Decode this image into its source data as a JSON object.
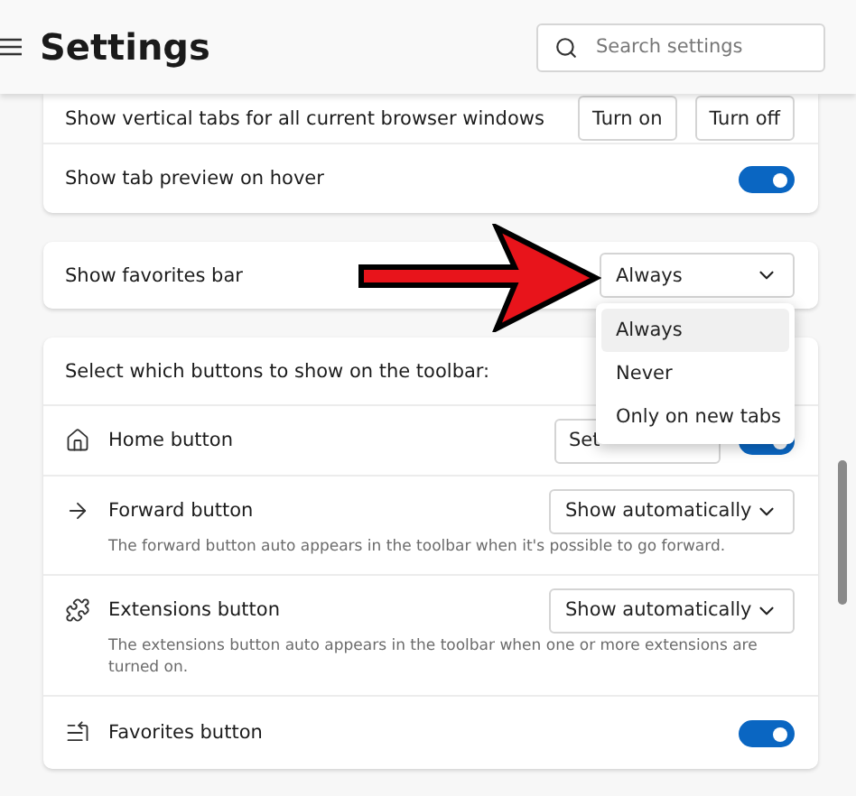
{
  "header": {
    "title": "Settings",
    "search": {
      "placeholder": "Search settings"
    }
  },
  "tabs_card": {
    "rows": [
      {
        "kind": "buttons",
        "label": "Show vertical tabs for all current browser windows",
        "buttons": [
          "Turn on",
          "Turn off"
        ]
      },
      {
        "kind": "toggle",
        "label": "Show tab preview on hover",
        "on": true
      }
    ]
  },
  "favorites_bar": {
    "label": "Show favorites bar",
    "value": "Always",
    "expanded": true,
    "options": [
      {
        "label": "Always",
        "selected": true
      },
      {
        "label": "Never",
        "selected": false
      },
      {
        "label": "Only on new tabs",
        "selected": false
      }
    ]
  },
  "toolbar_card": {
    "heading": "Select which buttons to show on the toolbar:",
    "rows": [
      {
        "kind": "button_toggle",
        "label": "Home button",
        "button": "Set",
        "on": true
      },
      {
        "kind": "select",
        "label": "Forward button",
        "value": "Show automatically",
        "description": "The forward button auto appears in the toolbar when it's possible to go forward."
      },
      {
        "kind": "select",
        "label": "Extensions button",
        "value": "Show automatically",
        "description": "The extensions button auto appears in the toolbar when one or more extensions are turned on."
      },
      {
        "kind": "toggle",
        "label": "Favorites button",
        "on": true
      }
    ]
  }
}
